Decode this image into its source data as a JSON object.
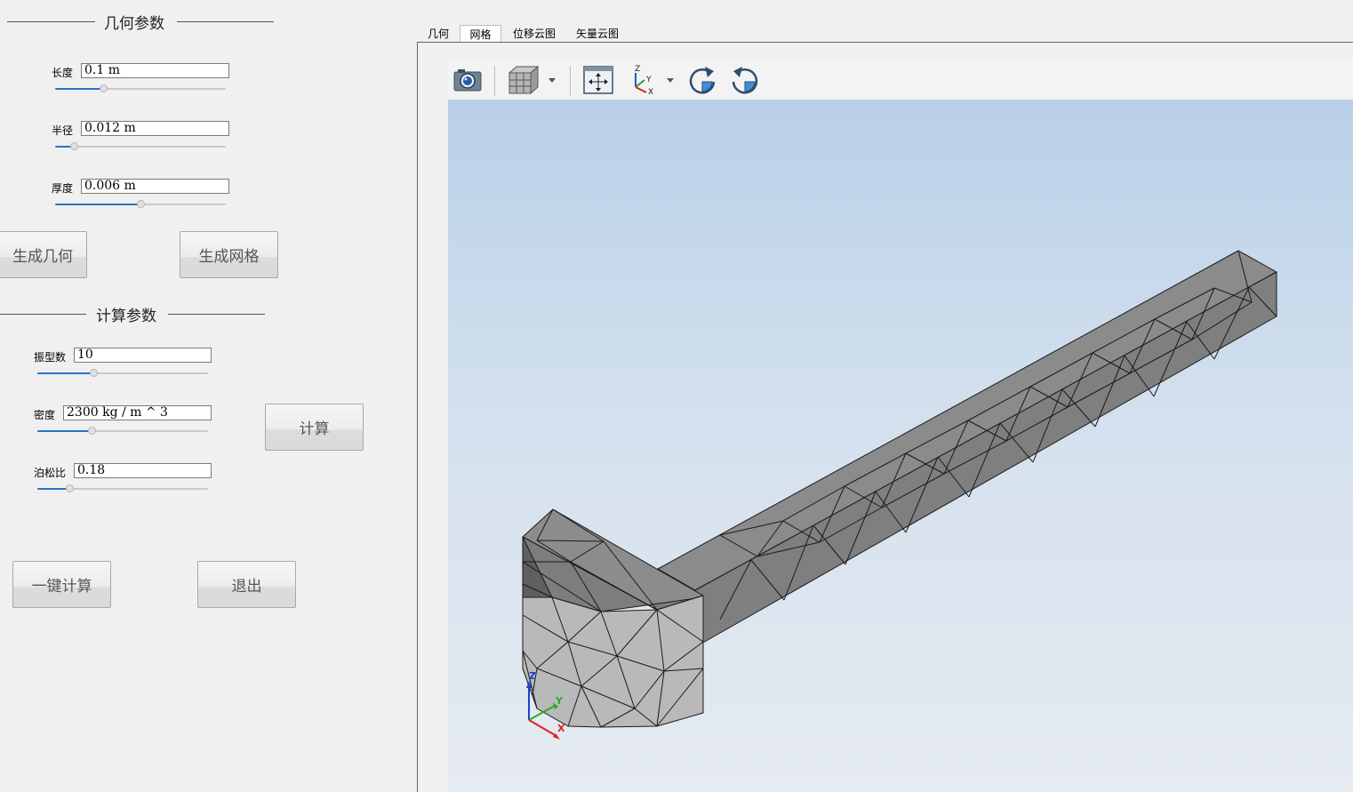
{
  "geometry_group": {
    "title": "几何参数"
  },
  "geometry_params": [
    {
      "label": "长度",
      "value": "0.1 m",
      "slider": 0.28
    },
    {
      "label": "半径",
      "value": "0.012 m",
      "slider": 0.11
    },
    {
      "label": "厚度",
      "value": "0.006 m",
      "slider": 0.5
    }
  ],
  "buttons": {
    "gen_geometry": "生成几何",
    "gen_mesh": "生成网格",
    "calculate": "计算",
    "one_click": "一键计算",
    "exit": "退出"
  },
  "calc_group": {
    "title": "计算参数"
  },
  "calc_params": [
    {
      "label": "振型数",
      "value": "10",
      "slider": 0.33
    },
    {
      "label": "密度",
      "value": "2300 kg / m ^ 3",
      "slider": 0.32
    },
    {
      "label": "泊松比",
      "value": "0.18",
      "slider": 0.19
    }
  ],
  "tabs": [
    {
      "label": "几何",
      "active": false
    },
    {
      "label": "网格",
      "active": true
    },
    {
      "label": "位移云图",
      "active": false
    },
    {
      "label": "矢量云图",
      "active": false
    }
  ],
  "toolbar": [
    "camera-icon",
    "view-cube-icon",
    "fit-all-icon",
    "axes-icon",
    "rotate-cw-icon",
    "rotate-ccw-icon"
  ],
  "triad": {
    "x": "X",
    "y": "Y",
    "z": "Z"
  },
  "colors": {
    "accent": "#2b72c8",
    "mesh_face": "#8f8f8f",
    "sky_top": "#b9d0e8",
    "sky_bottom": "#e6ebf1"
  }
}
